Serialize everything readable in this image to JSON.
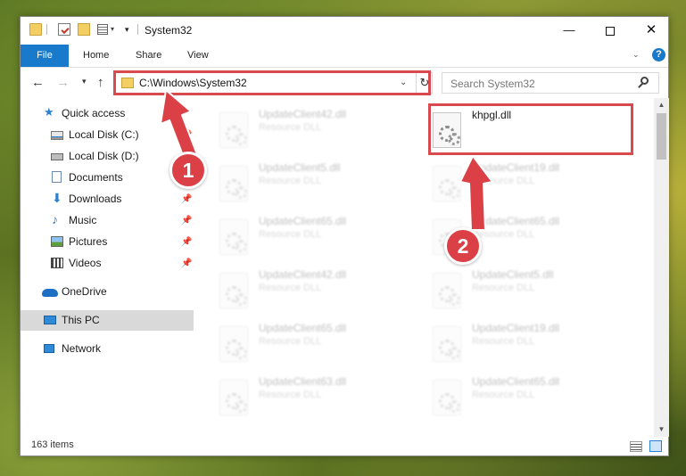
{
  "window": {
    "title": "System32",
    "controls": {
      "minimize": "—",
      "maximize": "",
      "close": "✕"
    }
  },
  "ribbon": {
    "tabs": [
      "File",
      "Home",
      "Share",
      "View"
    ],
    "help": "?"
  },
  "address": {
    "path": "C:\\Windows\\System32",
    "search_placeholder": "Search System32"
  },
  "sidebar": {
    "items": [
      {
        "label": "Quick access",
        "icon": "star-icon"
      },
      {
        "label": "Local Disk (C:)",
        "icon": "drive-icon",
        "pinned": true
      },
      {
        "label": "Local Disk (D:)",
        "icon": "drive-icon",
        "pinned": false
      },
      {
        "label": "Documents",
        "icon": "documents-icon",
        "pinned": true
      },
      {
        "label": "Downloads",
        "icon": "download-icon",
        "pinned": true
      },
      {
        "label": "Music",
        "icon": "music-icon",
        "pinned": true
      },
      {
        "label": "Pictures",
        "icon": "pictures-icon",
        "pinned": true
      },
      {
        "label": "Videos",
        "icon": "videos-icon",
        "pinned": true
      },
      {
        "label": "OneDrive",
        "icon": "cloud-icon"
      },
      {
        "label": "This PC",
        "icon": "pc-icon",
        "selected": true
      },
      {
        "label": "Network",
        "icon": "network-icon"
      }
    ]
  },
  "files": [
    {
      "name": "UpdateClient42.dll",
      "type": "Resource DLL"
    },
    {
      "name": "khpgl.dll",
      "type": "",
      "highlighted": true
    },
    {
      "name": "UpdateClient5.dll",
      "type": "Resource DLL"
    },
    {
      "name": "UpdateClient19.dll",
      "type": "Resource DLL"
    },
    {
      "name": "UpdateClient65.dll",
      "type": "Resource DLL"
    },
    {
      "name": "UpdateClient65.dll",
      "type": "Resource DLL"
    },
    {
      "name": "UpdateClient42.dll",
      "type": "Resource DLL"
    },
    {
      "name": "UpdateClient5.dll",
      "type": "Resource DLL"
    },
    {
      "name": "UpdateClient65.dll",
      "type": "Resource DLL"
    },
    {
      "name": "UpdateClient19.dll",
      "type": "Resource DLL"
    },
    {
      "name": "UpdateClient63.dll",
      "type": "Resource DLL"
    },
    {
      "name": "UpdateClient65.dll",
      "type": "Resource DLL"
    }
  ],
  "status": {
    "item_count": "163 items"
  },
  "callouts": [
    "1",
    "2"
  ],
  "colors": {
    "accent": "#1979ca",
    "highlight": "#d94a4f"
  }
}
